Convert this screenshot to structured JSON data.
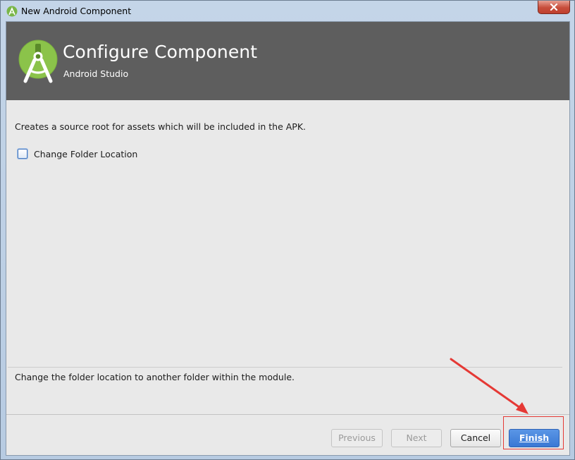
{
  "window": {
    "title": "New Android Component"
  },
  "header": {
    "title": "Configure Component",
    "subtitle": "Android Studio"
  },
  "content": {
    "description": "Creates a source root for assets which will be included in the APK.",
    "checkbox": {
      "label": "Change Folder Location",
      "checked": false
    },
    "help_text": "Change the folder location to another folder within the module."
  },
  "buttons": {
    "previous": {
      "label": "Previous",
      "enabled": false
    },
    "next": {
      "label": "Next",
      "enabled": false
    },
    "cancel": {
      "label": "Cancel",
      "enabled": true
    },
    "finish": {
      "label": "Finish",
      "enabled": true
    }
  },
  "annotation": {
    "color": "#e53935",
    "icon": "red-arrow-icon"
  },
  "colors": {
    "header_bg": "#5e5e5e",
    "android_green": "#8bc34a",
    "finish_blue": "#3a78d4"
  }
}
